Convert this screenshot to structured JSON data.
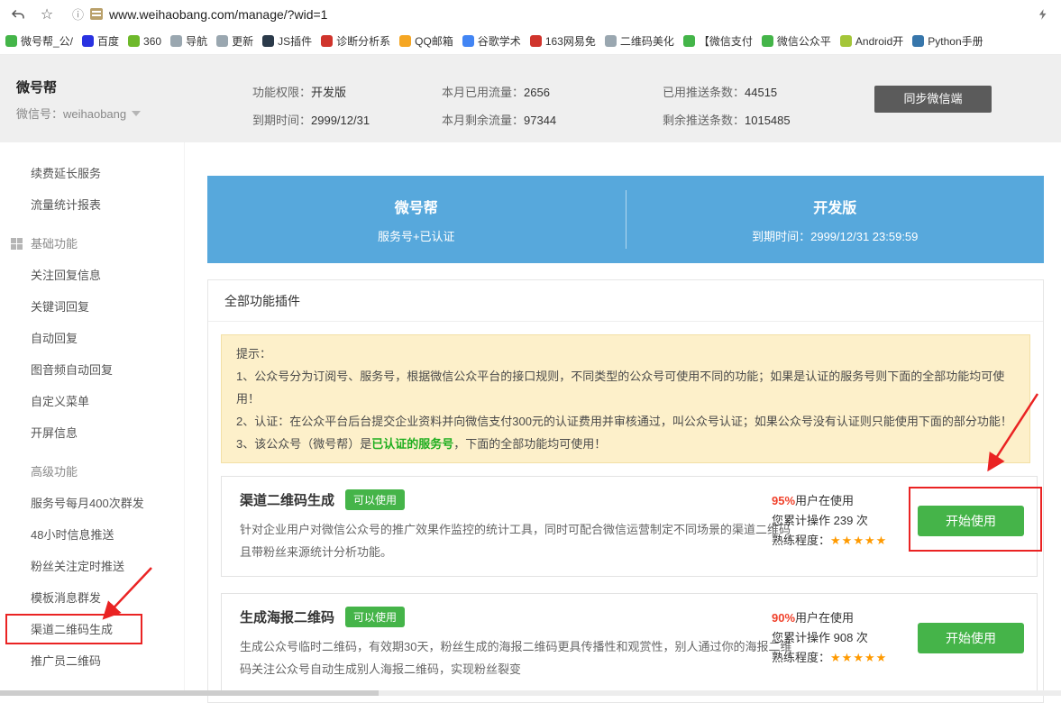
{
  "colors": {
    "blue": "#57a8dc",
    "green": "#45b449",
    "notice_bg": "#fdf0ca",
    "notice_border": "#f3e0a6",
    "star_orange": "#ff9a00",
    "annotation_red": "#ea2323",
    "usage_red": "#f0412b"
  },
  "browser": {
    "url": "www.weihaobang.com/manage/?wid=1",
    "bookmarks": [
      {
        "label": "微号帮_公/",
        "color": "#44b549"
      },
      {
        "label": "百度",
        "color": "#2932e1"
      },
      {
        "label": "360",
        "color": "#6eb92b"
      },
      {
        "label": "导航",
        "color": "#9aa7b0"
      },
      {
        "label": "更新",
        "color": "#9aa7b0"
      },
      {
        "label": "JS插件",
        "color": "#2b3a4a"
      },
      {
        "label": "诊断分析系",
        "color": "#d0342c"
      },
      {
        "label": "QQ邮箱",
        "color": "#f5a623"
      },
      {
        "label": "谷歌学术",
        "color": "#4285f4"
      },
      {
        "label": "163网易免",
        "color": "#d0342c"
      },
      {
        "label": "二维码美化",
        "color": "#9aa7b0"
      },
      {
        "label": "【微信支付",
        "color": "#44b549"
      },
      {
        "label": "微信公众平",
        "color": "#44b549"
      },
      {
        "label": "Android开",
        "color": "#a4c639"
      },
      {
        "label": "Python手册",
        "color": "#3776ab"
      }
    ]
  },
  "header": {
    "app_name": "微号帮",
    "account_label": "微信号：weihaobang",
    "stats": [
      {
        "label": "功能权限：",
        "value": "开发版"
      },
      {
        "label": "到期时间：",
        "value": "2999/12/31"
      },
      {
        "label": "本月已用流量：",
        "value": "2656"
      },
      {
        "label": "本月剩余流量：",
        "value": "97344"
      },
      {
        "label": "已用推送条数：",
        "value": "44515"
      },
      {
        "label": "剩余推送条数：",
        "value": "1015485"
      }
    ],
    "sync_button": "同步微信端"
  },
  "sidebar": {
    "items": [
      {
        "label": "续费延长服务"
      },
      {
        "label": "流量统计报表"
      },
      {
        "label": "基础功能"
      },
      {
        "label": "关注回复信息"
      },
      {
        "label": "关键词回复"
      },
      {
        "label": "自动回复"
      },
      {
        "label": "图音频自动回复"
      },
      {
        "label": "自定义菜单"
      },
      {
        "label": "开屏信息"
      },
      {
        "label": "高级功能"
      },
      {
        "label": "服务号每月400次群发"
      },
      {
        "label": "48小时信息推送"
      },
      {
        "label": "粉丝关注定时推送"
      },
      {
        "label": "模板消息群发"
      },
      {
        "label": "渠道二维码生成"
      },
      {
        "label": "推广员二维码"
      }
    ]
  },
  "banner": {
    "left_title": "微号帮",
    "left_subtitle": "服务号+已认证",
    "right_title": "开发版",
    "right_subtitle": "到期时间：2999/12/31 23:59:59"
  },
  "panel": {
    "title": "全部功能插件",
    "notice": {
      "title": "提示：",
      "line1": "1、公众号分为订阅号、服务号，根据微信公众平台的接口规则，不同类型的公众号可使用不同的功能；如果是认证的服务号则下面的全部功能均可使用！",
      "line2": "2、认证：在公众平台后台提交企业资料并向微信支付300元的认证费用并审核通过，叫公众号认证；如果公众号没有认证则只能使用下面的部分功能！",
      "line3_prefix": "3、该公众号（微号帮）是",
      "line3_highlight": "已认证的服务号",
      "line3_suffix": "，下面的全部功能均可使用！"
    },
    "cards": [
      {
        "title": "渠道二维码生成",
        "badge": "可以使用",
        "desc": "针对企业用户对微信公众号的推广效果作监控的统计工具，同时可配合微信运营制定不同场景的渠道二维码且带粉丝来源统计分析功能。",
        "usage_pct": "95%",
        "usage_text": "用户在使用",
        "ops_text": "您累计操作 239 次",
        "proficiency_label": "熟练程度：",
        "stars": "★★★★★",
        "button": "开始使用"
      },
      {
        "title": "生成海报二维码",
        "badge": "可以使用",
        "desc": "生成公众号临时二维码，有效期30天，粉丝生成的海报二维码更具传播性和观赏性，别人通过你的海报二维码关注公众号自动生成别人海报二维码，实现粉丝裂变",
        "usage_pct": "90%",
        "usage_text": "用户在使用",
        "ops_text": "您累计操作 908 次",
        "proficiency_label": "熟练程度：",
        "stars": "★★★★★",
        "button": "开始使用"
      }
    ]
  }
}
